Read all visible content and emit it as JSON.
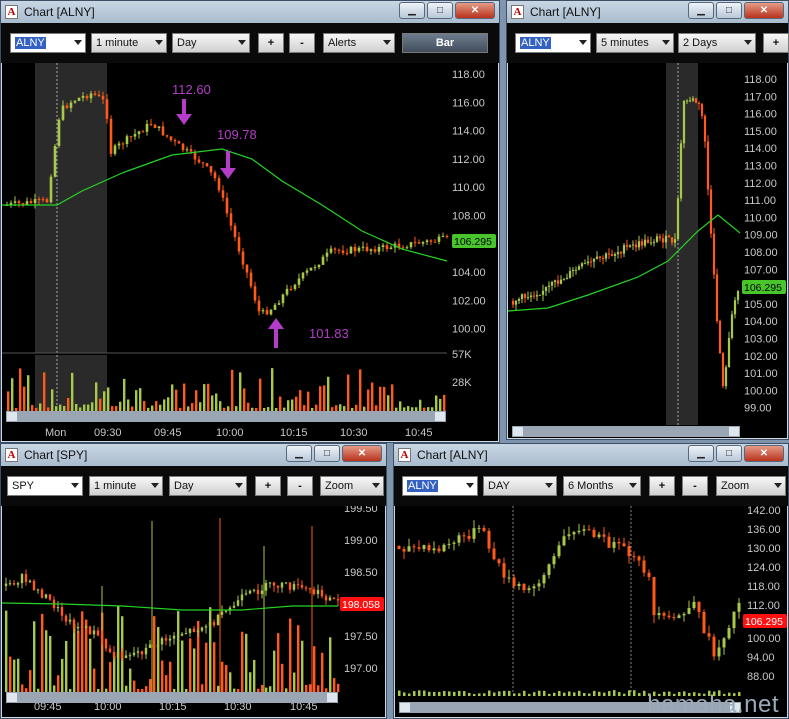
{
  "windows": {
    "w1": {
      "title": "Chart [ALNY]",
      "symbol": "ALNY",
      "interval": "1 minute",
      "range": "Day",
      "plus": "+",
      "minus": "-",
      "alerts": "Alerts",
      "bar": "Bar",
      "price_labels": [
        "118.00",
        "116.00",
        "114.00",
        "112.00",
        "110.00",
        "108.00",
        "106.00",
        "104.00",
        "102.00",
        "100.00"
      ],
      "vol_labels": [
        "57K",
        "28K"
      ],
      "time_labels": [
        "Mon",
        "09:30",
        "09:45",
        "10:00",
        "10:15",
        "10:30",
        "10:45"
      ],
      "annotations": [
        "112.60",
        "109.78",
        "101.83"
      ],
      "last_price": "106.295"
    },
    "w2": {
      "title": "Chart [ALNY]",
      "symbol": "ALNY",
      "interval": "5 minutes",
      "range": "2 Days",
      "plus": "+",
      "price_labels": [
        "118.00",
        "117.00",
        "116.00",
        "115.00",
        "114.00",
        "113.00",
        "112.00",
        "111.00",
        "110.00",
        "109.00",
        "108.00",
        "107.00",
        "106.00",
        "105.00",
        "104.00",
        "103.00",
        "102.00",
        "101.00",
        "100.00",
        "99.00"
      ],
      "last_price": "106.295"
    },
    "w3": {
      "title": "Chart [SPY]",
      "symbol": "SPY",
      "interval": "1 minute",
      "range": "Day",
      "plus": "+",
      "minus": "-",
      "zoom": "Zoom",
      "price_labels": [
        "199.50",
        "199.00",
        "198.50",
        "197.50",
        "197.00"
      ],
      "time_labels": [
        "09:45",
        "10:00",
        "10:15",
        "10:30",
        "10:45"
      ],
      "last_price": "198.058"
    },
    "w4": {
      "title": "Chart [ALNY]",
      "symbol": "ALNY",
      "interval": "DAY",
      "range": "6 Months",
      "plus": "+",
      "minus": "-",
      "zoom": "Zoom",
      "price_labels": [
        "142.00",
        "136.00",
        "130.00",
        "124.00",
        "118.00",
        "112.00",
        "100.00",
        "94.00",
        "88.00"
      ],
      "last_price": "106.295"
    }
  },
  "watermark": "hamaha.net",
  "colors": {
    "up": "#a8c84a",
    "down": "#ff5a1a",
    "ma": "#24d424",
    "annot": "#b43cc8",
    "axis_text": "#c8c8c8",
    "last_green": "#49c52c",
    "last_red": "#ff1010"
  },
  "icons": [
    "app-logo-icon",
    "minimize-icon",
    "maximize-icon",
    "close-icon",
    "dropdown-arrow-icon",
    "scroll-left-icon",
    "scroll-right-icon"
  ]
}
